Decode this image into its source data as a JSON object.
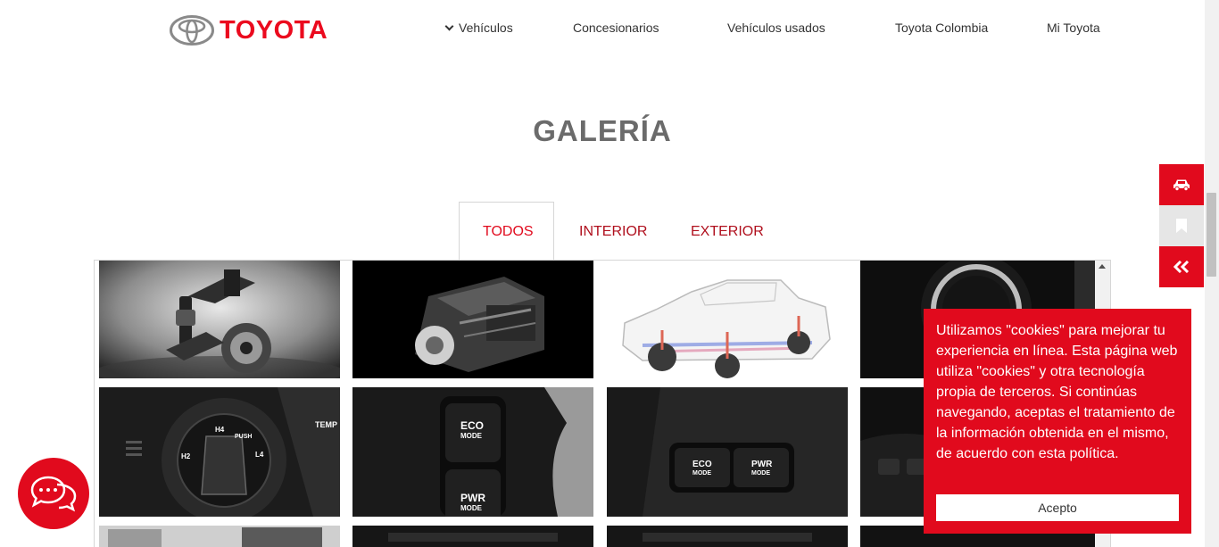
{
  "header": {
    "brand": "TOYOTA",
    "nav": [
      {
        "label": "Vehículos",
        "has_chevron": true
      },
      {
        "label": "Concesionarios"
      },
      {
        "label": "Vehículos usados"
      },
      {
        "label": "Toyota Colombia"
      },
      {
        "label": "Mi Toyota"
      }
    ]
  },
  "gallery": {
    "title": "GALERÍA",
    "tabs": [
      {
        "label": "TODOS",
        "active": true
      },
      {
        "label": "INTERIOR",
        "active": false
      },
      {
        "label": "EXTERIOR",
        "active": false
      }
    ],
    "thumbnails": [
      {
        "subject": "suspension",
        "icon": "suspension-photo"
      },
      {
        "subject": "engine",
        "icon": "engine-photo"
      },
      {
        "subject": "chassis-diagram",
        "icon": "chassis-photo"
      },
      {
        "subject": "knob",
        "icon": "knob-photo"
      },
      {
        "subject": "4wd-selector",
        "icon": "dial-photo",
        "labels": [
          "TEMP",
          "H4",
          "PUSH",
          "L4",
          "H2"
        ]
      },
      {
        "subject": "mode-buttons-vertical",
        "icon": "mode-buttons-photo",
        "labels": [
          "ECO",
          "MODE",
          "PWR",
          "MODE"
        ]
      },
      {
        "subject": "mode-buttons-horizontal",
        "icon": "mode-buttons-photo",
        "labels": [
          "ECO",
          "MODE",
          "PWR",
          "MODE"
        ]
      },
      {
        "subject": "outlets",
        "icon": "outlets-photo"
      }
    ]
  },
  "side_actions": [
    {
      "icon": "car-icon"
    },
    {
      "icon": "bookmark-icon"
    },
    {
      "icon": "double-chevron-left-icon"
    }
  ],
  "chat": {
    "icon": "chat-bubbles-icon"
  },
  "cookie_banner": {
    "text": "Utilizamos \"cookies\" para mejorar tu experiencia en línea. Esta página web utiliza \"cookies\" y otra tecnología propia de terceros. Si continúas navegando, aceptas el tratamiento de la información obtenida en el mismo, de acuerdo con esta política.",
    "accept_label": "Acepto"
  },
  "colors": {
    "brand_red": "#e10a1d",
    "title_grey": "#6b6b6b",
    "tab_red": "#b0101e"
  }
}
